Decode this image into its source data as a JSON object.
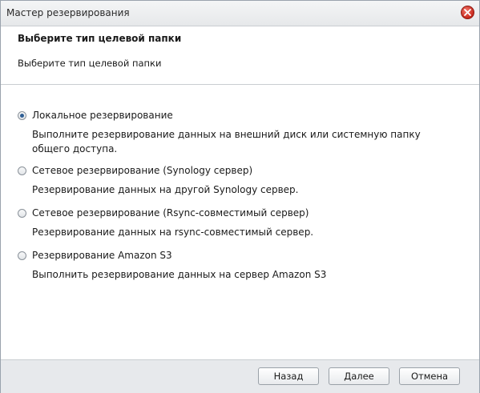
{
  "window": {
    "title": "Мастер резервирования",
    "close_icon": "close-icon"
  },
  "header": {
    "title": "Выберите тип целевой папки",
    "subtitle": "Выберите тип целевой папки"
  },
  "options": [
    {
      "label": "Локальное резервирование",
      "description": "Выполните резервирование данных на внешний диск или системную папку общего доступа.",
      "selected": true
    },
    {
      "label": "Сетевое резервирование (Synology сервер)",
      "description": "Резервирование данных на другой Synology сервер.",
      "selected": false
    },
    {
      "label": "Сетевое резервирование (Rsync-совместимый сервер)",
      "description": "Резервирование данных на rsync-совместимый сервер.",
      "selected": false
    },
    {
      "label": "Резервирование Amazon S3",
      "description": "Выполнить резервирование данных на сервер Amazon S3",
      "selected": false
    }
  ],
  "footer": {
    "back_label": "Назад",
    "next_label": "Далее",
    "cancel_label": "Отмена"
  },
  "colors": {
    "accent": "#2f5f95",
    "close": "#c8281c"
  }
}
